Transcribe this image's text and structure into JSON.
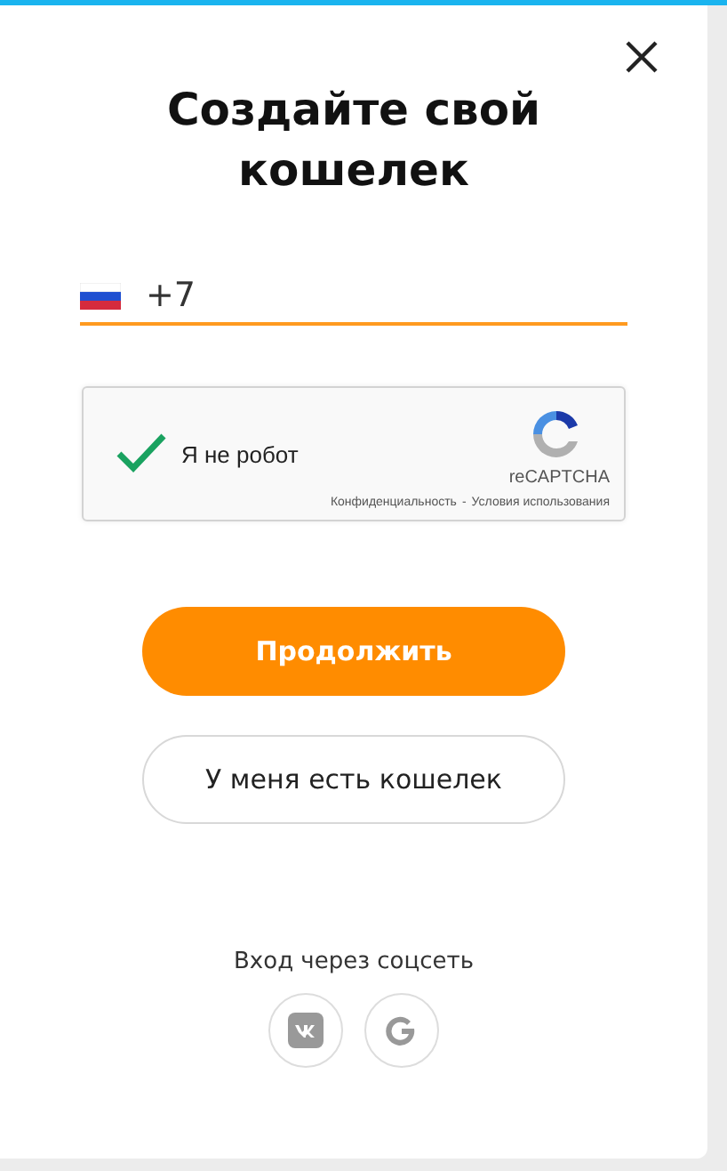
{
  "dialog": {
    "title": "Создайте свой кошелек"
  },
  "phone": {
    "value": "+7"
  },
  "recaptcha": {
    "checked": true,
    "label": "Я не робот",
    "brand": "reCAPTCHA",
    "privacy": "Конфиденциальность",
    "separator": "-",
    "terms": "Условия использования"
  },
  "buttons": [
    {
      "label": "Продолжить",
      "kind": "primary"
    },
    {
      "label": "У меня есть кошелек",
      "kind": "secondary"
    }
  ],
  "social": {
    "title": "Вход через соцсеть",
    "networks": [
      {
        "kind": "vk"
      },
      {
        "kind": "google"
      }
    ]
  }
}
